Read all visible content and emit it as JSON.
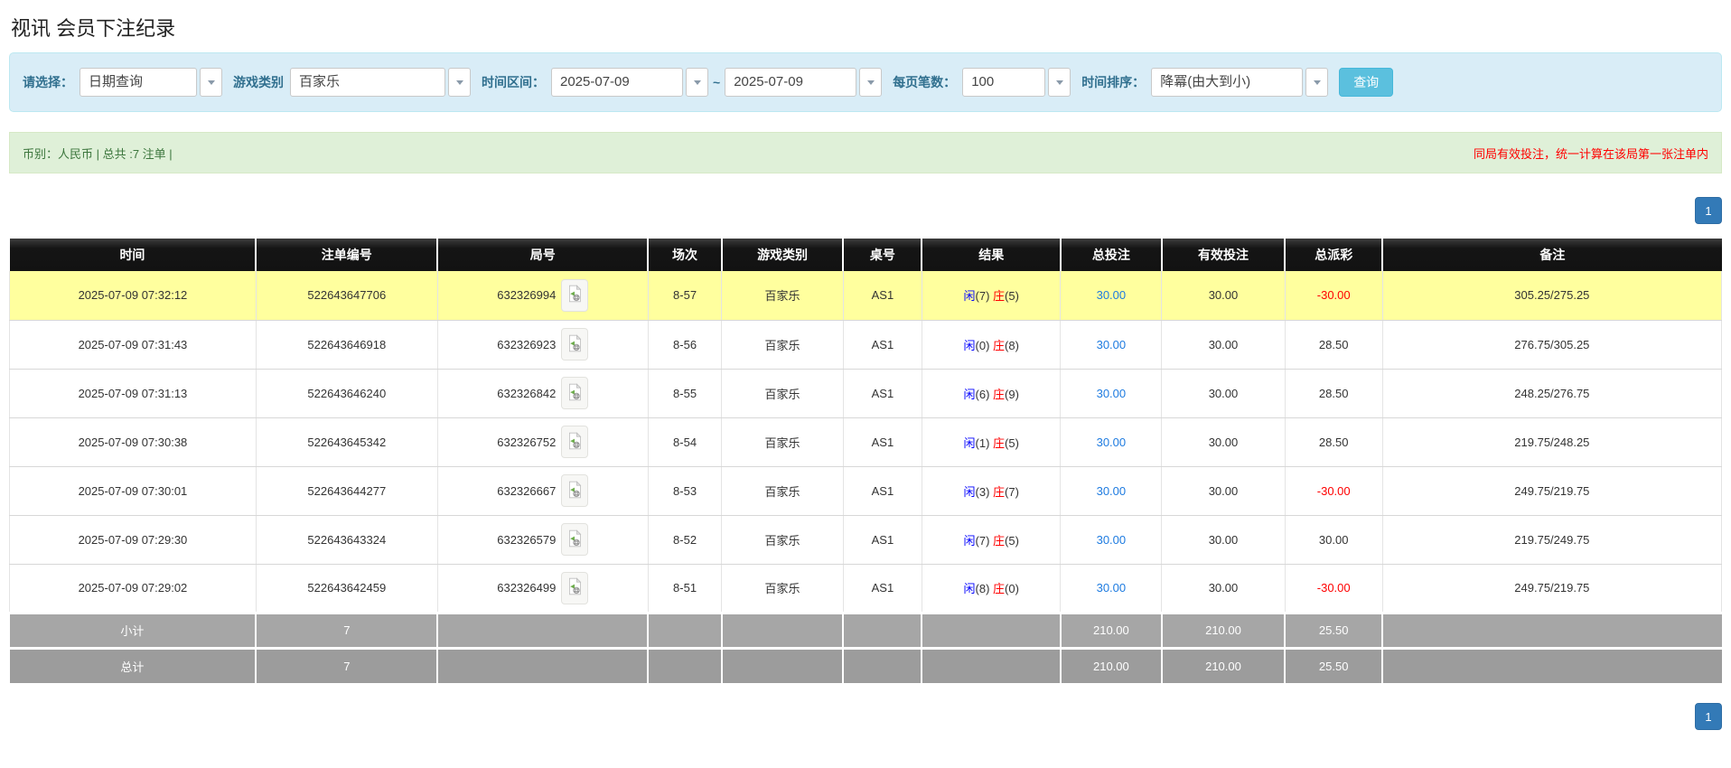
{
  "page": {
    "title": "视讯 会员下注纪录"
  },
  "filters": {
    "select_label": "请选择：",
    "select_value": "日期查询",
    "game_type_label": "游戏类别",
    "game_type_value": "百家乐",
    "time_range_label": "时间区间：",
    "date_from": "2025-07-09",
    "tilde": "~",
    "date_to": "2025-07-09",
    "page_size_label": "每页笔数：",
    "page_size_value": "100",
    "sort_label": "时间排序：",
    "sort_value": "降冪(由大到小)",
    "search_button": "查询"
  },
  "summary": {
    "left": "币别：人民币 | 总共 :7 注单 |",
    "right_notice": "同局有效投注，统一计算在该局第一张注单内"
  },
  "pagination": {
    "page": "1"
  },
  "icons": {
    "combo_arrow": "chevron-down-icon",
    "round_video": "video-file-icon"
  },
  "colors": {
    "header_bg": "#1a1a1a",
    "highlight_row": "#ffff9e",
    "player_blue": "#0000fe",
    "banker_red": "#ff0000",
    "negative_red": "#ff0000",
    "link_blue": "#1e7be0",
    "panel_bg": "#d9edf7",
    "summary_bg": "#dff0d8",
    "summary_text": "#3c763d",
    "notice_red": "#ff0000",
    "search_button_blue": "#5bc0de",
    "pagination_blue": "#337ab7",
    "subtotal_gray": "#a6a6a6",
    "grandtotal_gray": "#9c9c9c"
  },
  "table": {
    "headers": [
      "时间",
      "注单编号",
      "局号",
      "场次",
      "游戏类别",
      "桌号",
      "结果",
      "总投注",
      "有效投注",
      "总派彩",
      "备注"
    ],
    "rows": [
      {
        "time": "2025-07-09 07:32:12",
        "bet_id": "522643647706",
        "round_id": "632326994",
        "session": "8-57",
        "game": "百家乐",
        "table_no": "AS1",
        "result": {
          "player": "闲(7)",
          "banker": "庄(5)"
        },
        "total_bet": "30.00",
        "valid_bet": "30.00",
        "payout": "-30.00",
        "remark": "305.25/275.25",
        "highlight": true
      },
      {
        "time": "2025-07-09 07:31:43",
        "bet_id": "522643646918",
        "round_id": "632326923",
        "session": "8-56",
        "game": "百家乐",
        "table_no": "AS1",
        "result": {
          "player": "闲(0)",
          "banker": "庄(8)"
        },
        "total_bet": "30.00",
        "valid_bet": "30.00",
        "payout": "28.50",
        "remark": "276.75/305.25",
        "highlight": false
      },
      {
        "time": "2025-07-09 07:31:13",
        "bet_id": "522643646240",
        "round_id": "632326842",
        "session": "8-55",
        "game": "百家乐",
        "table_no": "AS1",
        "result": {
          "player": "闲(6)",
          "banker": "庄(9)"
        },
        "total_bet": "30.00",
        "valid_bet": "30.00",
        "payout": "28.50",
        "remark": "248.25/276.75",
        "highlight": false
      },
      {
        "time": "2025-07-09 07:30:38",
        "bet_id": "522643645342",
        "round_id": "632326752",
        "session": "8-54",
        "game": "百家乐",
        "table_no": "AS1",
        "result": {
          "player": "闲(1)",
          "banker": "庄(5)"
        },
        "total_bet": "30.00",
        "valid_bet": "30.00",
        "payout": "28.50",
        "remark": "219.75/248.25",
        "highlight": false
      },
      {
        "time": "2025-07-09 07:30:01",
        "bet_id": "522643644277",
        "round_id": "632326667",
        "session": "8-53",
        "game": "百家乐",
        "table_no": "AS1",
        "result": {
          "player": "闲(3)",
          "banker": "庄(7)"
        },
        "total_bet": "30.00",
        "valid_bet": "30.00",
        "payout": "-30.00",
        "remark": "249.75/219.75",
        "highlight": false
      },
      {
        "time": "2025-07-09 07:29:30",
        "bet_id": "522643643324",
        "round_id": "632326579",
        "session": "8-52",
        "game": "百家乐",
        "table_no": "AS1",
        "result": {
          "player": "闲(7)",
          "banker": "庄(5)"
        },
        "total_bet": "30.00",
        "valid_bet": "30.00",
        "payout": "30.00",
        "remark": "219.75/249.75",
        "highlight": false
      },
      {
        "time": "2025-07-09 07:29:02",
        "bet_id": "522643642459",
        "round_id": "632326499",
        "session": "8-51",
        "game": "百家乐",
        "table_no": "AS1",
        "result": {
          "player": "闲(8)",
          "banker": "庄(0)"
        },
        "total_bet": "30.00",
        "valid_bet": "30.00",
        "payout": "-30.00",
        "remark": "249.75/219.75",
        "highlight": false
      }
    ],
    "footer": [
      {
        "label": "小计",
        "count": "7",
        "total_bet": "210.00",
        "valid_bet": "210.00",
        "payout": "25.50"
      },
      {
        "label": "总计",
        "count": "7",
        "total_bet": "210.00",
        "valid_bet": "210.00",
        "payout": "25.50"
      }
    ]
  }
}
